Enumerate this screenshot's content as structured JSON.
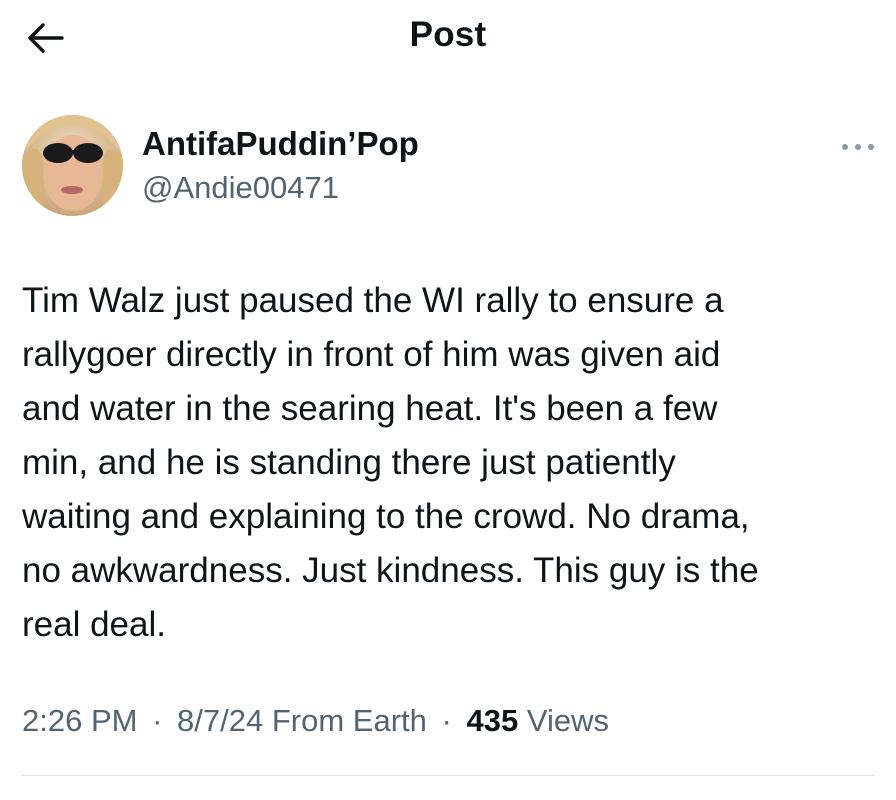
{
  "header": {
    "title": "Post",
    "back_icon": "arrow-left-icon"
  },
  "author": {
    "display_name": "AntifaPuddin’Pop",
    "handle": "@Andie00471",
    "avatar_icon": "user-avatar",
    "more_icon": "more-horizontal-icon"
  },
  "post": {
    "text": "Tim Walz just paused the WI rally to ensure a\nrallygoer directly in front of him was given aid\nand water in the searing heat. It's been a few\nmin, and he is standing there just patiently\nwaiting and explaining to the crowd. No drama,\nno awkwardness. Just kindness. This guy is the\nreal deal."
  },
  "meta": {
    "time": "2:26 PM",
    "separator": "·",
    "date": "8/7/24",
    "source": "From Earth",
    "views_count": "435",
    "views_label": "Views"
  },
  "colors": {
    "text_primary": "#0f1419",
    "text_secondary": "#536471",
    "divider": "#e1e4e7",
    "background": "#ffffff"
  }
}
